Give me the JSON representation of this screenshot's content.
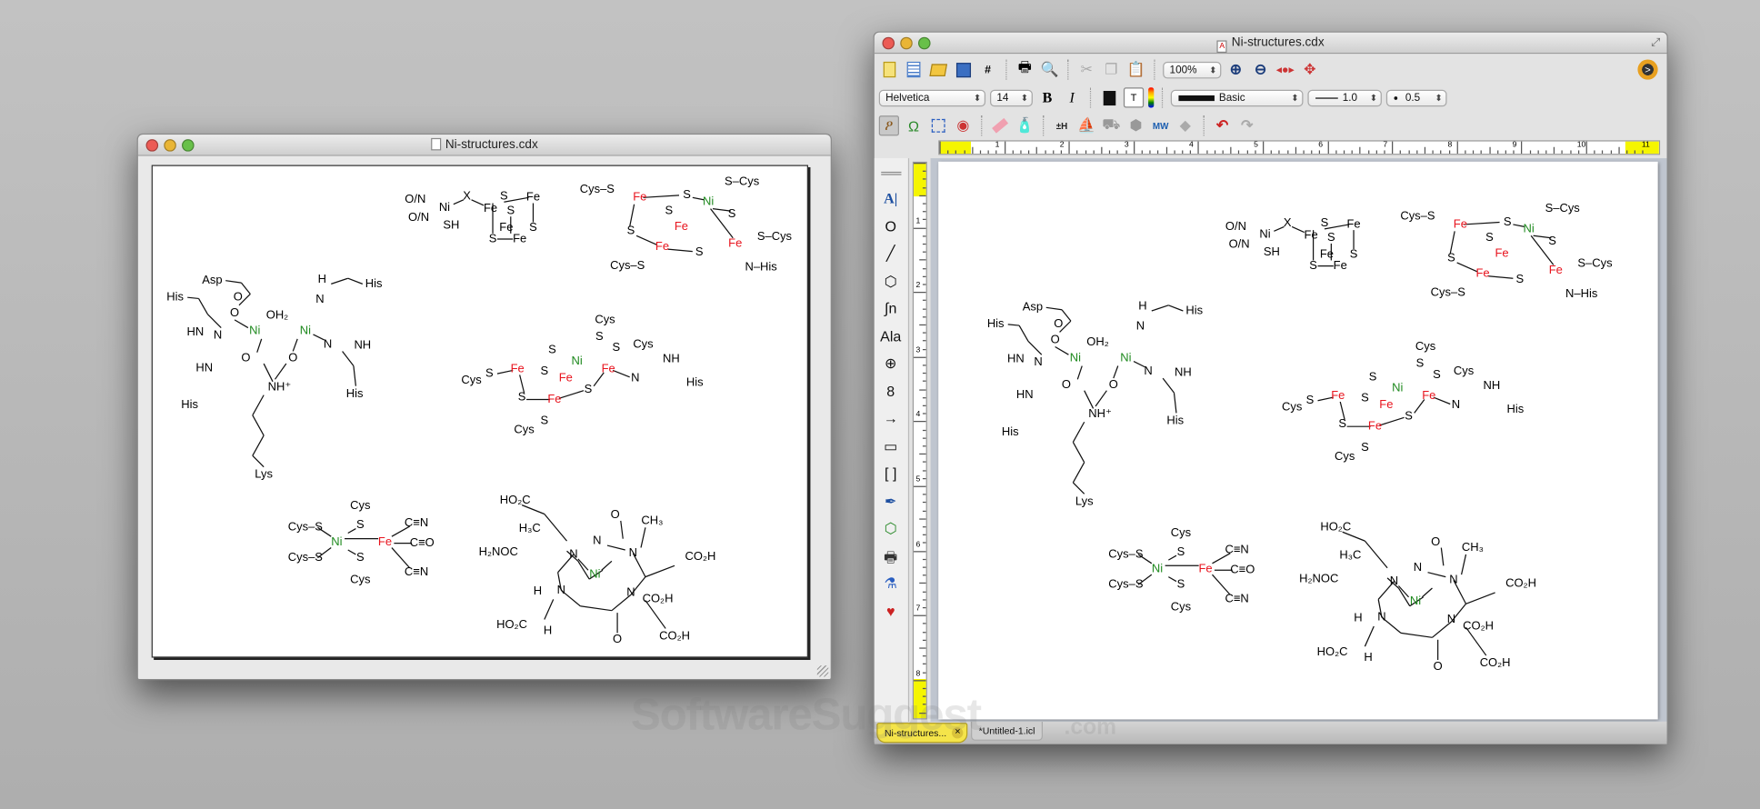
{
  "left_window": {
    "title": "Ni-structures.cdx"
  },
  "right_window": {
    "title": "Ni-structures.cdx",
    "toolbar": {
      "zoom": "100%",
      "font": "Helvetica",
      "size": "14",
      "bold": "B",
      "italic": "I",
      "line_style": "Basic",
      "line_width": "1.0",
      "dot_size": "0.5"
    },
    "tabs": [
      {
        "label": "Ni-structures..."
      },
      {
        "label": "*Untitled-1.icl"
      }
    ],
    "palette": [
      {
        "g": "A|"
      },
      {
        "g": "O"
      },
      {
        "g": "╱"
      },
      {
        "g": "⬡"
      },
      {
        "g": "∫n"
      },
      {
        "g": "Ala"
      },
      {
        "g": "⊕"
      },
      {
        "g": "8"
      },
      {
        "g": "→"
      },
      {
        "g": "▭"
      },
      {
        "g": "[ ]"
      }
    ],
    "ruler_h": [
      "1",
      "2",
      "3",
      "4",
      "5",
      "6",
      "7",
      "8",
      "9",
      "10",
      "11"
    ],
    "ruler_v": [
      "1",
      "2",
      "3",
      "4",
      "5",
      "6",
      "7",
      "8"
    ]
  },
  "colors": {
    "ni": "#1f8a1f",
    "fe": "#e8141e",
    "highlight": "#f5f500"
  },
  "molecules": [
    {
      "name": "ni-urease-site",
      "labels": [
        {
          "t": "Asp"
        },
        {
          "t": "His"
        },
        {
          "t": "O"
        },
        {
          "t": "O"
        },
        {
          "t": "OH₂"
        },
        {
          "t": "HN"
        },
        {
          "t": "N"
        },
        {
          "t": "Ni",
          "c": "ni"
        },
        {
          "t": "N"
        },
        {
          "t": "H"
        },
        {
          "t": "His"
        },
        {
          "t": "Ni",
          "c": "ni"
        },
        {
          "t": "N"
        },
        {
          "t": "NH"
        },
        {
          "t": "O"
        },
        {
          "t": "O"
        },
        {
          "t": "HN"
        },
        {
          "t": "NH⁺"
        },
        {
          "t": "His"
        },
        {
          "t": "His"
        },
        {
          "t": "Lys"
        }
      ]
    },
    {
      "name": "ni-x-fe4s4",
      "labels": [
        {
          "t": "O/N"
        },
        {
          "t": "O/N"
        },
        {
          "t": "Ni"
        },
        {
          "t": "SH"
        },
        {
          "t": "X"
        },
        {
          "t": "Fe"
        },
        {
          "t": "S"
        },
        {
          "t": "Fe"
        },
        {
          "t": "S"
        },
        {
          "t": "Fe"
        },
        {
          "t": "S"
        },
        {
          "t": "S"
        },
        {
          "t": "Fe"
        }
      ]
    },
    {
      "name": "nife-cluster-a",
      "labels": [
        {
          "t": "Cys–S"
        },
        {
          "t": "Fe",
          "c": "fe"
        },
        {
          "t": "S"
        },
        {
          "t": "Ni",
          "c": "ni"
        },
        {
          "t": "S–Cys"
        },
        {
          "t": "S"
        },
        {
          "t": "S"
        },
        {
          "t": "S"
        },
        {
          "t": "Fe",
          "c": "fe"
        },
        {
          "t": "Fe",
          "c": "fe"
        },
        {
          "t": "Fe",
          "c": "fe"
        },
        {
          "t": "S–Cys"
        },
        {
          "t": "S"
        },
        {
          "t": "Cys–S"
        },
        {
          "t": "N–His"
        }
      ]
    },
    {
      "name": "nife-cluster-b",
      "labels": [
        {
          "t": "Cys"
        },
        {
          "t": "S"
        },
        {
          "t": "S"
        },
        {
          "t": "Cys"
        },
        {
          "t": "S"
        },
        {
          "t": "Ni",
          "c": "ni"
        },
        {
          "t": "Cys"
        },
        {
          "t": "S"
        },
        {
          "t": "Fe",
          "c": "fe"
        },
        {
          "t": "S"
        },
        {
          "t": "Fe",
          "c": "fe"
        },
        {
          "t": "Fe",
          "c": "fe"
        },
        {
          "t": "N"
        },
        {
          "t": "NH"
        },
        {
          "t": "His"
        },
        {
          "t": "S"
        },
        {
          "t": "Fe",
          "c": "fe"
        },
        {
          "t": "S"
        },
        {
          "t": "S"
        },
        {
          "t": "Cys"
        }
      ]
    },
    {
      "name": "nife-hydrogenase",
      "labels": [
        {
          "t": "Cys"
        },
        {
          "t": "S"
        },
        {
          "t": "Cys–S"
        },
        {
          "t": "Ni",
          "c": "ni"
        },
        {
          "t": "Fe",
          "c": "fe"
        },
        {
          "t": "C≡N"
        },
        {
          "t": "C≡O"
        },
        {
          "t": "C≡N"
        },
        {
          "t": "Cys–S"
        },
        {
          "t": "S"
        },
        {
          "t": "Cys"
        }
      ]
    },
    {
      "name": "cofactor-f430",
      "labels": [
        {
          "t": "O"
        },
        {
          "t": "HO₂C"
        },
        {
          "t": "H₃C"
        },
        {
          "t": "CH₃"
        },
        {
          "t": "H₂NOC"
        },
        {
          "t": "N"
        },
        {
          "t": "N"
        },
        {
          "t": "N"
        },
        {
          "t": "Ni",
          "c": "ni"
        },
        {
          "t": "N"
        },
        {
          "t": "N"
        },
        {
          "t": "CO₂H"
        },
        {
          "t": "H"
        },
        {
          "t": "CO₂H"
        },
        {
          "t": "HO₂C"
        },
        {
          "t": "H"
        },
        {
          "t": "O"
        },
        {
          "t": "CO₂H"
        }
      ]
    }
  ],
  "watermark": {
    "main": "SoftwareSuggest",
    "suffix": ".com"
  }
}
